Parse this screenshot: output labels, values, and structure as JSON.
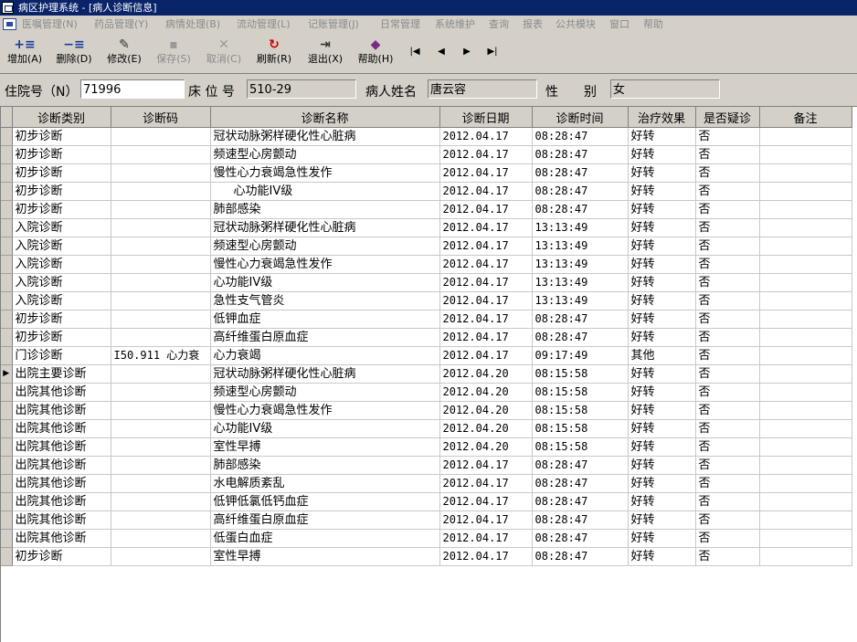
{
  "window": {
    "title": "病区护理系统 - [病人诊断信息]"
  },
  "menu": [
    "医嘱管理(N)",
    "药品管理(Y)",
    "病情处理(B)",
    "流动管理(L)",
    "记账管理(J)",
    "日常管理",
    "系统维护",
    "查询",
    "报表",
    "公共模块",
    "窗口",
    "帮助"
  ],
  "toolbar": {
    "add": "增加(A)",
    "delete": "删除(D)",
    "edit": "修改(E)",
    "save": "保存(S)",
    "cancel": "取消(C)",
    "refresh": "刷新(R)",
    "exit": "退出(X)",
    "help": "帮助(H)"
  },
  "patient": {
    "admission_no_label": "住院号（N）",
    "admission_no": "71996",
    "bed_label": "床 位 号",
    "bed": "510-29",
    "name_label": "病人姓名",
    "name": "唐云容",
    "sex_label": "性　　别",
    "sex": "女"
  },
  "grid": {
    "columns": [
      "诊断类别",
      "诊断码",
      "诊断名称",
      "诊断日期",
      "诊断时间",
      "治疗效果",
      "是否疑诊",
      "备注"
    ],
    "rows": [
      [
        "初步诊断",
        "",
        "冠状动脉粥样硬化性心脏病",
        "2012.04.17",
        "08:28:47",
        "好转",
        "否",
        ""
      ],
      [
        "初步诊断",
        "",
        "频速型心房颤动",
        "2012.04.17",
        "08:28:47",
        "好转",
        "否",
        ""
      ],
      [
        "初步诊断",
        "",
        "慢性心力衰竭急性发作",
        "2012.04.17",
        "08:28:47",
        "好转",
        "否",
        ""
      ],
      [
        "初步诊断",
        "",
        "心功能IV级",
        "2012.04.17",
        "08:28:47",
        "好转",
        "否",
        ""
      ],
      [
        "初步诊断",
        "",
        "肺部感染",
        "2012.04.17",
        "08:28:47",
        "好转",
        "否",
        ""
      ],
      [
        "入院诊断",
        "",
        "冠状动脉粥样硬化性心脏病",
        "2012.04.17",
        "13:13:49",
        "好转",
        "否",
        ""
      ],
      [
        "入院诊断",
        "",
        "频速型心房颤动",
        "2012.04.17",
        "13:13:49",
        "好转",
        "否",
        ""
      ],
      [
        "入院诊断",
        "",
        "慢性心力衰竭急性发作",
        "2012.04.17",
        "13:13:49",
        "好转",
        "否",
        ""
      ],
      [
        "入院诊断",
        "",
        "心功能IV级",
        "2012.04.17",
        "13:13:49",
        "好转",
        "否",
        ""
      ],
      [
        "入院诊断",
        "",
        "急性支气管炎",
        "2012.04.17",
        "13:13:49",
        "好转",
        "否",
        ""
      ],
      [
        "初步诊断",
        "",
        "低钾血症",
        "2012.04.17",
        "08:28:47",
        "好转",
        "否",
        ""
      ],
      [
        "初步诊断",
        "",
        "高纤维蛋白原血症",
        "2012.04.17",
        "08:28:47",
        "好转",
        "否",
        ""
      ],
      [
        "门诊诊断",
        "I50.911 心力衰",
        "心力衰竭",
        "2012.04.17",
        "09:17:49",
        "其他",
        "否",
        ""
      ],
      [
        "出院主要诊断",
        "",
        "冠状动脉粥样硬化性心脏病",
        "2012.04.20",
        "08:15:58",
        "好转",
        "否",
        ""
      ],
      [
        "出院其他诊断",
        "",
        "频速型心房颤动",
        "2012.04.20",
        "08:15:58",
        "好转",
        "否",
        ""
      ],
      [
        "出院其他诊断",
        "",
        "慢性心力衰竭急性发作",
        "2012.04.20",
        "08:15:58",
        "好转",
        "否",
        ""
      ],
      [
        "出院其他诊断",
        "",
        "心功能IV级",
        "2012.04.20",
        "08:15:58",
        "好转",
        "否",
        ""
      ],
      [
        "出院其他诊断",
        "",
        "室性早搏",
        "2012.04.20",
        "08:15:58",
        "好转",
        "否",
        ""
      ],
      [
        "出院其他诊断",
        "",
        "肺部感染",
        "2012.04.17",
        "08:28:47",
        "好转",
        "否",
        ""
      ],
      [
        "出院其他诊断",
        "",
        "水电解质紊乱",
        "2012.04.17",
        "08:28:47",
        "好转",
        "否",
        ""
      ],
      [
        "出院其他诊断",
        "",
        "低钾低氯低钙血症",
        "2012.04.17",
        "08:28:47",
        "好转",
        "否",
        ""
      ],
      [
        "出院其他诊断",
        "",
        "高纤维蛋白原血症",
        "2012.04.17",
        "08:28:47",
        "好转",
        "否",
        ""
      ],
      [
        "出院其他诊断",
        "",
        "低蛋白血症",
        "2012.04.17",
        "08:28:47",
        "好转",
        "否",
        ""
      ],
      [
        "初步诊断",
        "",
        "室性早搏",
        "2012.04.17",
        "08:28:47",
        "好转",
        "否",
        ""
      ]
    ]
  }
}
